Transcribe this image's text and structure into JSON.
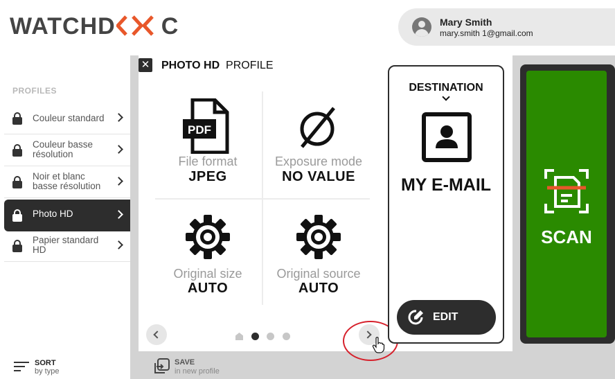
{
  "header": {
    "logo_prefix": "WATCHD",
    "logo_suffix": "C",
    "user": {
      "name": "Mary Smith",
      "email": "mary.smith 1@gmail.com"
    }
  },
  "sidebar": {
    "title": "PROFILES",
    "items": [
      {
        "label": "Couleur standard"
      },
      {
        "label": "Couleur basse résolution"
      },
      {
        "label": "Noir et blanc basse résolution"
      },
      {
        "label": "Photo HD"
      },
      {
        "label": "Papier standard HD"
      }
    ],
    "sort": {
      "title": "SORT",
      "subtitle": "by type"
    }
  },
  "panel": {
    "close_glyph": "✕",
    "title_bold": "PHOTO HD",
    "title_rest": "PROFILE",
    "settings": [
      {
        "label": "File format",
        "value": "JPEG",
        "icon": "pdf-file-icon",
        "icon_text": "PDF"
      },
      {
        "label": "Exposure mode",
        "value": "NO VALUE",
        "icon": "empty-set-icon"
      },
      {
        "label": "Original size",
        "value": "AUTO",
        "icon": "gear-icon"
      },
      {
        "label": "Original source",
        "value": "AUTO",
        "icon": "gear-icon"
      }
    ],
    "pagination": {
      "pages": 4,
      "current": 2
    },
    "save": {
      "title": "SAVE",
      "subtitle": "in new profile"
    }
  },
  "destination": {
    "title": "DESTINATION",
    "label": "MY E-MAIL",
    "edit_label": "EDIT"
  },
  "scan": {
    "label": "SCAN"
  },
  "colors": {
    "accent_orange": "#e8572a",
    "dark": "#2d2d2d",
    "scan_green": "#2a8a00",
    "highlight_red": "#d6202b"
  }
}
